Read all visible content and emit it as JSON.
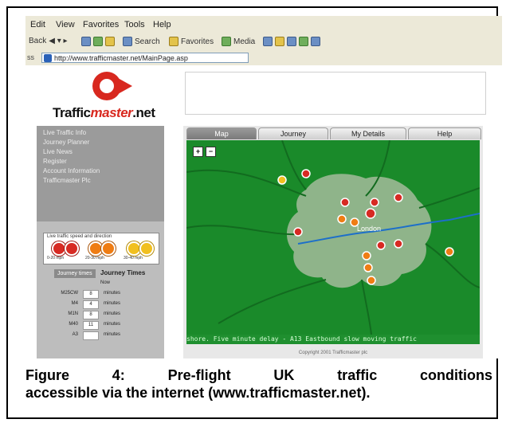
{
  "browser": {
    "menu": [
      "Edit",
      "View",
      "Favorites",
      "Tools",
      "Help"
    ],
    "toolbar": {
      "back": "Back",
      "search": "Search",
      "favorites": "Favorites",
      "media": "Media"
    },
    "address_label": "ss",
    "address_url": "http://www.trafficmaster.net/MainPage.asp"
  },
  "site": {
    "logo_text_a": "Traffic",
    "logo_text_b": "master",
    "logo_text_c": ".net",
    "sidebar_links": [
      "Live Traffic Info",
      "Journey Planner",
      "Live News",
      "Register",
      "Account Information",
      "Trafficmaster Plc"
    ],
    "legend": {
      "title": "Live traffic speed and direction",
      "captions": [
        "0-20 mph",
        "20-30 mph",
        "30-40 mph"
      ]
    },
    "journey_times": {
      "heading_btn": "Journey times",
      "heading": "Journey Times",
      "sub": "Now",
      "rows": [
        {
          "road": "M25CW",
          "value": "8",
          "unit": "minutes"
        },
        {
          "road": "M4",
          "value": "4",
          "unit": "minutes"
        },
        {
          "road": "M1N",
          "value": "8",
          "unit": "minutes"
        },
        {
          "road": "M40",
          "value": "11",
          "unit": "minutes"
        },
        {
          "road": "A3",
          "value": "",
          "unit": "minutes"
        }
      ]
    },
    "tabs": [
      "Map",
      "Journey",
      "My Details",
      "Help"
    ],
    "map_city_label": "London",
    "ticker": "shore. Five minute delay  -  A13 Eastbound slow moving traffic",
    "copyright": "Copyright 2001 Trafficmaster plc",
    "colors": {
      "map_bg": "#1a8a2a",
      "urban": "#8fb48a",
      "incident_red": "#d72a23",
      "incident_orange": "#ef7d14"
    }
  },
  "caption": {
    "line1": "Figure 4: Pre-flight UK traffic conditions",
    "line2": "accessible via the internet (www.trafficmaster.net)."
  }
}
